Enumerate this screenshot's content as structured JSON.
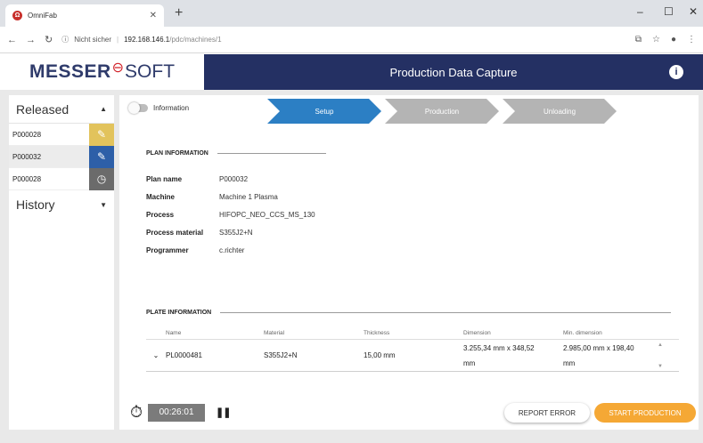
{
  "browser": {
    "tab_title": "OmniFab",
    "tab_favicon_icon": "omnifab-favicon-icon",
    "url_security": "Nicht sicher",
    "url_host": "192.168.146.1",
    "url_path": "/pdc/machines/1"
  },
  "header": {
    "logo_part1": "MESSER",
    "logo_part2": "SOFT",
    "title": "Production Data Capture",
    "info_icon": "i"
  },
  "sidebar": {
    "released_label": "Released",
    "history_label": "History",
    "items": [
      {
        "label": "P000028",
        "icon": "tools-icon",
        "color": "#e2c35c"
      },
      {
        "label": "P000032",
        "icon": "tools-icon",
        "color": "#2d5fa8"
      },
      {
        "label": "P000028",
        "icon": "clock-icon",
        "color": "#6b6b6b"
      }
    ]
  },
  "toggle": {
    "label": "Information"
  },
  "steps": [
    {
      "label": "Setup",
      "state": "active",
      "color": "#2c7fc4"
    },
    {
      "label": "Production",
      "state": "inactive",
      "color": "#b4b4b4"
    },
    {
      "label": "Unloading",
      "state": "inactive",
      "color": "#b4b4b4"
    }
  ],
  "plan": {
    "section_title": "PLAN INFORMATION",
    "fields": [
      {
        "key": "Plan name",
        "value": "P000032"
      },
      {
        "key": "Machine",
        "value": "Machine 1 Plasma"
      },
      {
        "key": "Process",
        "value": "HIFOPC_NEO_CCS_MS_130"
      },
      {
        "key": "Process material",
        "value": "S355J2+N"
      },
      {
        "key": "Programmer",
        "value": "c.richter"
      }
    ]
  },
  "plate": {
    "section_title": "PLATE INFORMATION",
    "columns": [
      "Name",
      "Material",
      "Thickness",
      "Dimension",
      "Min. dimension"
    ],
    "rows": [
      {
        "name": "PL0000481",
        "material": "S355J2+N",
        "thickness": "15,00 mm",
        "dimension_1": "3.255,34 mm x 348,52",
        "dimension_2": "mm",
        "min_dimension_1": "2.985,00 mm x 198,40",
        "min_dimension_2": "mm"
      }
    ]
  },
  "footer": {
    "timer": "00:26:01",
    "report_button": "REPORT ERROR",
    "start_button": "START PRODUCTION"
  },
  "colors": {
    "header_bg": "#243063",
    "accent_orange": "#f5a835",
    "step_active": "#2c7fc4",
    "step_inactive": "#b4b4b4",
    "logo_red": "#d2232a"
  }
}
